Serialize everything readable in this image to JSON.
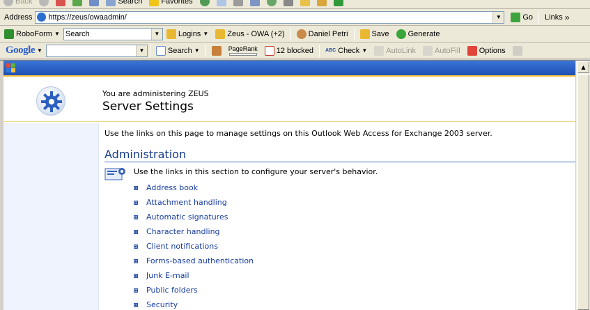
{
  "browser": {
    "top_toolbar": {
      "back_label": "Back",
      "search_label": "Search",
      "favorites_label": "Favorites"
    },
    "address_bar": {
      "label": "Address",
      "url": "https://zeus/owaadmin/",
      "go_label": "Go",
      "links_label": "Links",
      "chevron": "»"
    },
    "roboform_bar": {
      "roboform_label": "RoboForm",
      "search_value": "Search",
      "logins_label": "Logins",
      "site_label": "Zeus - OWA (+2)",
      "user_label": "Daniel Petri",
      "save_label": "Save",
      "generate_label": "Generate"
    },
    "google_bar": {
      "brand": "Google",
      "search_label": "Search",
      "pagerank_label": "PageRank",
      "blocked_label": "12 blocked",
      "check_icon_text": "ABC",
      "check_label": "Check",
      "autolink_label": "AutoLink",
      "autofill_label": "AutoFill",
      "options_label": "Options"
    }
  },
  "page": {
    "admin_of": "You are administering ZEUS",
    "title": "Server Settings",
    "intro": "Use the links on this page to manage settings on this Outlook Web Access for Exchange 2003 server.",
    "section": {
      "title": "Administration",
      "description": "Use the links in this section to configure your server's behavior.",
      "links": [
        "Address book",
        "Attachment handling",
        "Automatic signatures",
        "Character handling",
        "Client notifications",
        "Forms-based authentication",
        "Junk E-mail",
        "Public folders",
        "Security"
      ]
    }
  },
  "colors": {
    "owa_band": "#2b63c6",
    "accent_gold": "#f3c23c",
    "link": "#163ca0",
    "nav_bg": "#eef3fd"
  }
}
